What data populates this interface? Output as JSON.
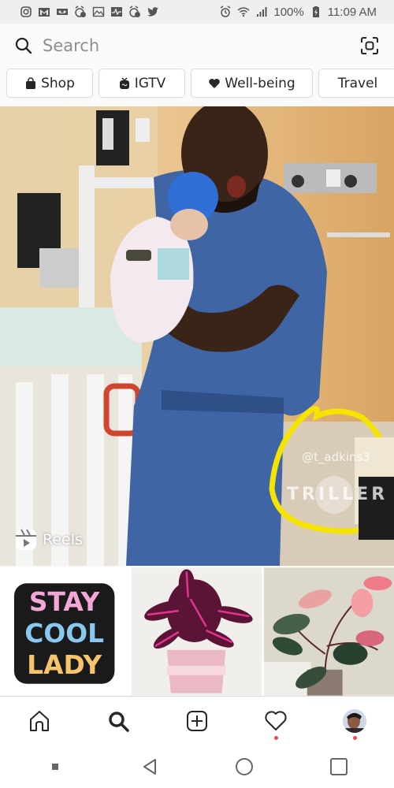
{
  "status_bar": {
    "left_icons": [
      "instagram-icon",
      "gmail-icon",
      "voicemail-icon",
      "alarm-alert-icon",
      "gallery-icon",
      "activity-icon",
      "alarm-alert-icon",
      "twitter-icon"
    ],
    "battery": "100%",
    "time": "11:09 AM"
  },
  "search": {
    "placeholder": "Search"
  },
  "chips": [
    {
      "label": "Shop",
      "icon": "shopping-bag-icon"
    },
    {
      "label": "IGTV",
      "icon": "igtv-icon"
    },
    {
      "label": "Well-being",
      "icon": "heart-icon"
    },
    {
      "label": "Travel",
      "icon": ""
    }
  ],
  "featured": {
    "type_label": "Reels",
    "watermark_user": "@t_adkins3",
    "watermark_brand": "TRILLER",
    "annotation_color": "#f5e300"
  },
  "grid_tiles": [
    {
      "description": "Stay Cool Lady tie-dye lettering",
      "text": "STAY COOL LADY"
    },
    {
      "description": "Pink and purple iresine plant in pot"
    },
    {
      "description": "Pink princess philodendron plant"
    }
  ],
  "bottom_nav": {
    "items": [
      "home",
      "search",
      "new-post",
      "activity",
      "profile"
    ],
    "notification_color": "#ed4956"
  }
}
